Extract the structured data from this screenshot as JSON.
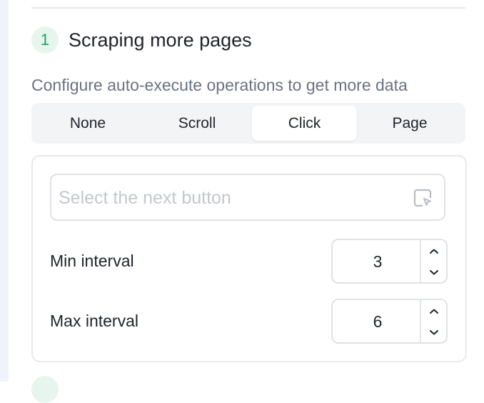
{
  "section": {
    "step_number": "1",
    "title": "Scraping more pages",
    "description": "Configure auto-execute operations to get more data"
  },
  "mode_tabs": [
    {
      "label": "None",
      "active": false
    },
    {
      "label": "Scroll",
      "active": false
    },
    {
      "label": "Click",
      "active": true
    },
    {
      "label": "Page",
      "active": false
    }
  ],
  "next_button_selector": {
    "value": "",
    "placeholder": "Select the next button",
    "icon": "element-picker-icon"
  },
  "min_interval": {
    "label": "Min interval",
    "value": "3"
  },
  "max_interval": {
    "label": "Max interval",
    "value": "6"
  },
  "colors": {
    "accent_green": "#21a067",
    "badge_bg": "#e6f6ee",
    "segment_bg": "#f3f4f6",
    "placeholder": "#c4c7cc"
  }
}
